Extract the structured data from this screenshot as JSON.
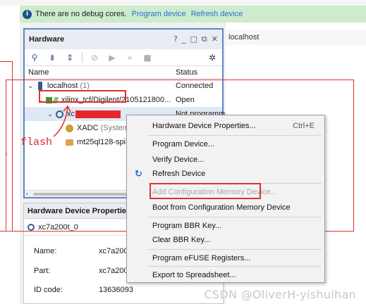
{
  "info_bar": {
    "message": "There are no debug cores.",
    "program_link": "Program device",
    "refresh_link": "Refresh device"
  },
  "localhost_tab": {
    "label": "localhost"
  },
  "hardware_panel": {
    "title": "Hardware",
    "window_controls": {
      "help": "?",
      "minimize": "_",
      "restore": "□",
      "float": "⧉",
      "close": "✕"
    },
    "columns": {
      "name": "Name",
      "status": "Status"
    },
    "tree": {
      "localhost": {
        "name": "localhost",
        "count": "(1)",
        "status": "Connected"
      },
      "target": {
        "name": "xilinx_tcf/Digilent/2105121800...",
        "status": "Open"
      },
      "device": {
        "name": "xc",
        "status": "Not programm"
      },
      "xadc": {
        "name": "XADC",
        "suffix": "(System"
      },
      "flash": {
        "name": "mt25ql128-spi-"
      }
    },
    "annotation": "flash"
  },
  "device_properties": {
    "title": "Hardware Device Properties",
    "device": "xc7a200t_0",
    "rows": [
      {
        "key": "Name:",
        "value": "xc7a200t"
      },
      {
        "key": "Part:",
        "value": "xc7a200t"
      },
      {
        "key": "ID code:",
        "value": "13636093"
      }
    ]
  },
  "context_menu": {
    "items": [
      {
        "label": "Hardware Device Properties...",
        "shortcut": "Ctrl+E"
      },
      {
        "label": "Program Device..."
      },
      {
        "label": "Verify Device..."
      },
      {
        "label": "Refresh Device"
      },
      {
        "label": "Add Configuration Memory Device..."
      },
      {
        "label": "Boot from Configuration Memory Device"
      },
      {
        "label": "Program BBR Key..."
      },
      {
        "label": "Clear BBR Key..."
      },
      {
        "label": "Program eFUSE Registers..."
      },
      {
        "label": "Export to Spreadsheet..."
      }
    ]
  },
  "watermark": "CSDN @OliverH-yishuihan",
  "colors": {
    "info_bg": "#cdebcd",
    "link": "#2a6fd6",
    "panel_border": "#5b88c8",
    "annotation_red": "#e03030"
  }
}
